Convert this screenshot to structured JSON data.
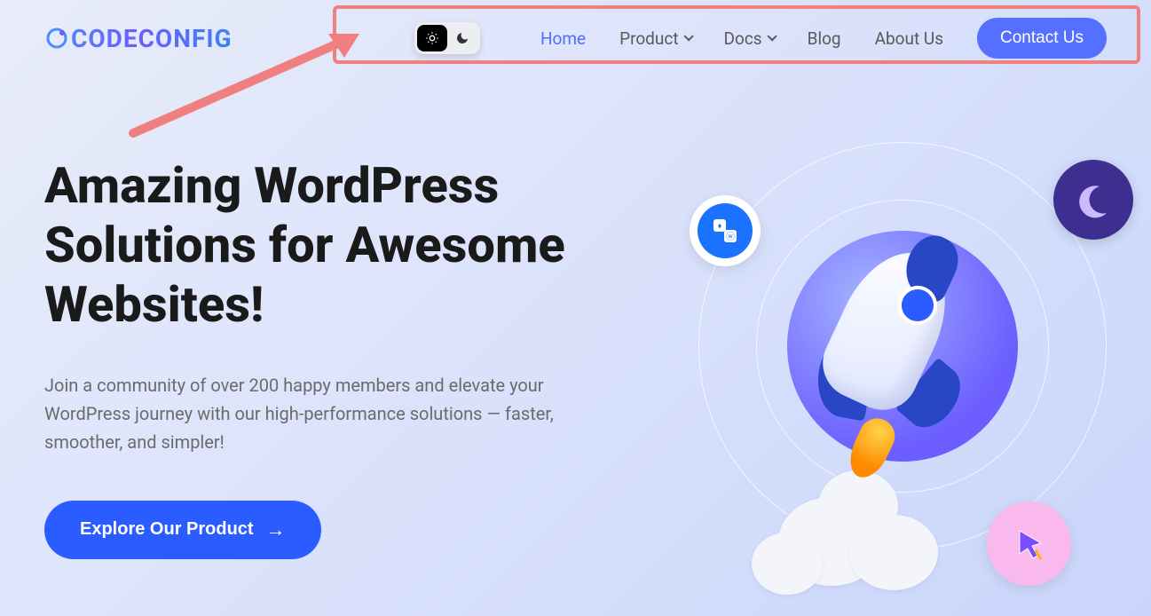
{
  "brand": {
    "name": "CODECONFIG"
  },
  "nav": {
    "home": "Home",
    "product": "Product",
    "docs": "Docs",
    "blog": "Blog",
    "about": "About Us",
    "contact": "Contact Us"
  },
  "theme_toggle": {
    "light_icon": "sun-icon",
    "dark_icon": "moon-icon",
    "active": "light"
  },
  "hero": {
    "title": "Amazing WordPress Solutions for Awesome Websites!",
    "description": "Join a community of over 200 happy members and elevate your WordPress journey with our high-performance solutions — faster, smoother, and simpler!",
    "cta": "Explore Our Product"
  },
  "annotation": {
    "type": "highlight-box-with-arrow",
    "color": "#f08080"
  },
  "illustration": {
    "badges": [
      "dropbox-wordpress-icon",
      "moon-crescent-icon",
      "cursor-icon"
    ],
    "main": "rocket"
  }
}
